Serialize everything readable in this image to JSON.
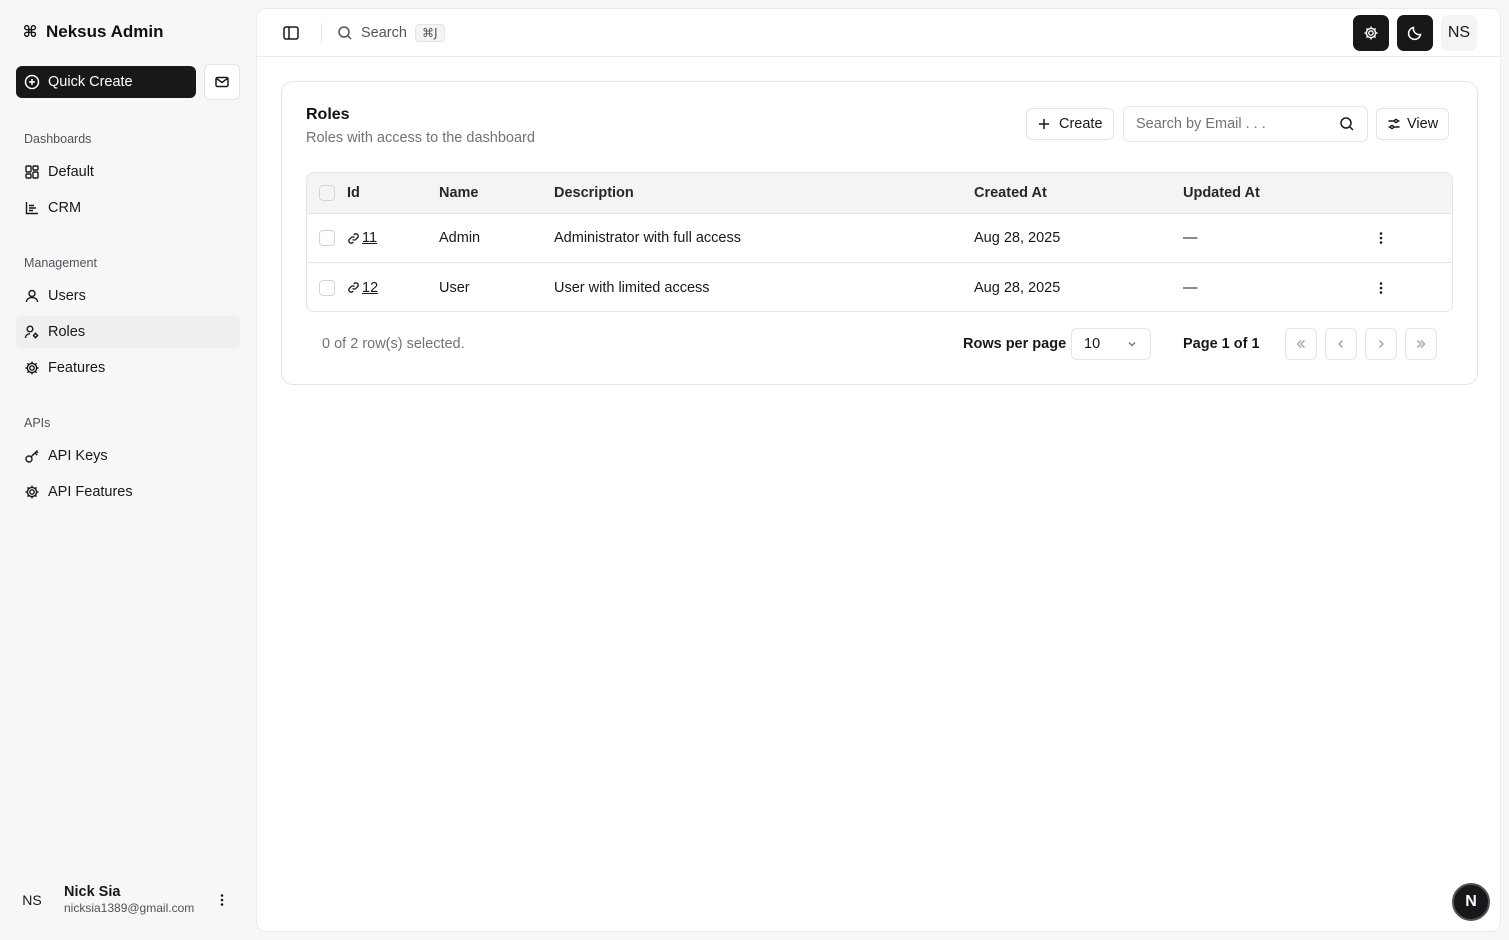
{
  "app": {
    "title": "Neksus Admin"
  },
  "sidebar": {
    "quick_create_label": "Quick Create",
    "groups": [
      {
        "label": "Dashboards",
        "items": [
          {
            "label": "Default"
          },
          {
            "label": "CRM"
          }
        ]
      },
      {
        "label": "Management",
        "items": [
          {
            "label": "Users"
          },
          {
            "label": "Roles",
            "active": true
          },
          {
            "label": "Features"
          }
        ]
      },
      {
        "label": "APIs",
        "items": [
          {
            "label": "API Keys"
          },
          {
            "label": "API Features"
          }
        ]
      }
    ],
    "user": {
      "initials": "NS",
      "name": "Nick Sia",
      "email": "nicksia1389@gmail.com"
    }
  },
  "topbar": {
    "search_label": "Search",
    "search_shortcut": "⌘J",
    "avatar_initials": "NS"
  },
  "card": {
    "title": "Roles",
    "description": "Roles with access to the dashboard",
    "create_label": "Create",
    "search_placeholder": "Search by Email . . .",
    "view_label": "View"
  },
  "table": {
    "columns": [
      "Id",
      "Name",
      "Description",
      "Created At",
      "Updated At"
    ],
    "rows": [
      {
        "id": "11",
        "name": "Admin",
        "description": "Administrator with full access",
        "created_at": "Aug 28, 2025",
        "updated_at": "—"
      },
      {
        "id": "12",
        "name": "User",
        "description": "User with limited access",
        "created_at": "Aug 28, 2025",
        "updated_at": "—"
      }
    ]
  },
  "footer": {
    "selected_text": "0 of 2 row(s) selected.",
    "rows_per_page_label": "Rows per page",
    "rows_per_page_value": "10",
    "page_label": "Page 1 of 1"
  },
  "floating": {
    "label": "N"
  },
  "colors": {
    "primary": "#18181b",
    "border": "#e4e4e7",
    "muted_text": "#71717a",
    "header_bg": "#f4f4f5"
  }
}
